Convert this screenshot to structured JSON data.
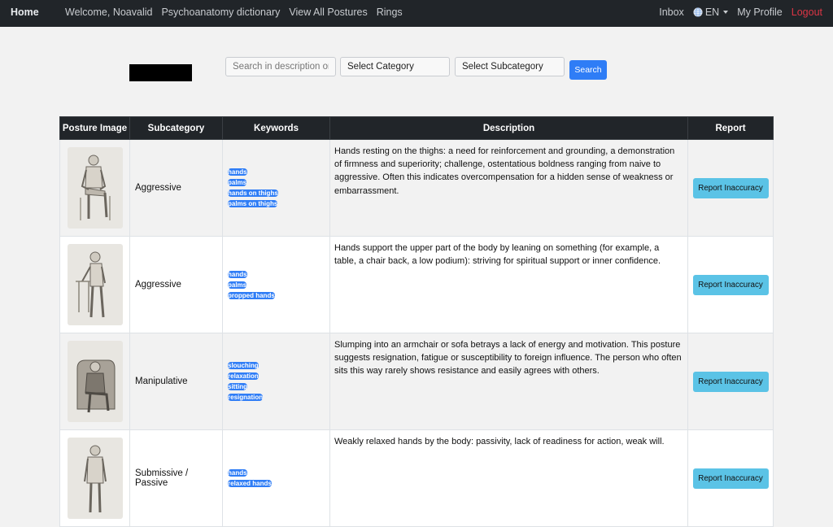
{
  "nav": {
    "home": "Home",
    "welcome": "Welcome, Noavalid",
    "dictionary": "Psychoanatomy dictionary",
    "all_postures": "View All Postures",
    "rings": "Rings",
    "inbox": "Inbox",
    "language": "EN",
    "profile": "My Profile",
    "logout": "Logout"
  },
  "search": {
    "placeholder": "Search in description or keywords",
    "category": "Select Category",
    "subcategory": "Select Subcategory",
    "button": "Search"
  },
  "table": {
    "headers": [
      "Posture Image",
      "Subcategory",
      "Keywords",
      "Description",
      "Report"
    ],
    "rows": [
      {
        "subcategory": "Aggressive",
        "keywords": [
          "hands",
          "palms",
          "hands on thighs",
          "palms on thighs"
        ],
        "description": "Hands resting on the thighs: a need for reinforcement and grounding, a demonstration of firmness and superiority; challenge, ostentatious boldness ranging from naive to aggressive. Often this indicates overcompensation for a hidden sense of weakness or embarrassment.",
        "report": "Report Inaccuracy"
      },
      {
        "subcategory": "Aggressive",
        "keywords": [
          "hands",
          "palms",
          "propped hands"
        ],
        "description": "Hands support the upper part of the body by leaning on something (for example, a table, a chair back, a low podium): striving for spiritual support or inner confidence.",
        "report": "Report Inaccuracy"
      },
      {
        "subcategory": "Manipulative",
        "keywords": [
          "slouching",
          "relaxation",
          "sitting",
          "resignation"
        ],
        "description": "Slumping into an armchair or sofa betrays a lack of energy and motivation. This posture suggests resignation, fatigue or susceptibility to foreign influence. The person who often sits this way rarely shows resistance and easily agrees with others.",
        "report": "Report Inaccuracy"
      },
      {
        "subcategory": "Submissive / Passive",
        "keywords": [
          "hands",
          "relaxed hands"
        ],
        "description": "Weakly relaxed hands by the body: passivity, lack of readiness for action, weak will.",
        "report": "Report Inaccuracy"
      }
    ]
  },
  "colors": {
    "navbar": "#212529",
    "primary": "#2f7df6",
    "info": "#5bc3e6",
    "danger": "#dc3545"
  }
}
